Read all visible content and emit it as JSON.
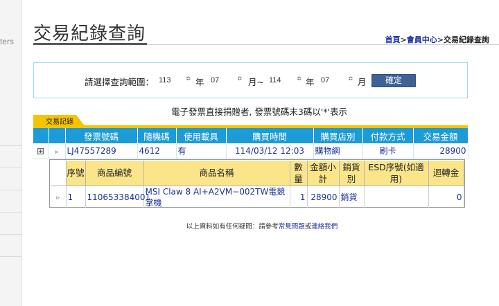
{
  "sidebar": {
    "fragment": "ters"
  },
  "header": {
    "title": "交易紀錄查詢",
    "breadcrumb": {
      "home": "首頁",
      "member": "會員中心",
      "current": "交易紀錄查詢",
      "separator": ">"
    }
  },
  "query": {
    "label": "請選擇查詢範圍：",
    "from_year": "113",
    "from_year_unit": "年",
    "from_month": "07",
    "from_month_unit": "月~",
    "to_year": "114",
    "to_year_unit": "年",
    "to_month": "07",
    "to_month_unit": "月",
    "spinner_icon": "≎",
    "confirm_label": "確定"
  },
  "notice": "電子發票直接捐贈者, 發票號碼末3碼以'*'表示",
  "tab_label": "交易記錄",
  "main_table": {
    "headers": [
      "發票號碼",
      "隨機碼",
      "使用載具",
      "購買時間",
      "購買店別",
      "付款方式",
      "交易金額"
    ],
    "row": {
      "expand": "+",
      "arrow": "▹",
      "invoice": "LJ47557289",
      "random_code": "4612",
      "carrier": "有",
      "time": "114/03/12 12:03",
      "store": "購物網",
      "payment": "刷卡",
      "amount": "28900"
    }
  },
  "detail_table": {
    "headers": [
      "序號",
      "商品編號",
      "商品名稱",
      "數量",
      "金額小計",
      "銷貨別",
      "ESD序號(如適用)",
      "迴轉金"
    ],
    "row": {
      "arrow": "▹",
      "seq": "1",
      "product_no": "110653384001",
      "product_name": "MSI Claw 8 AI+A2VM−002TW電競掌機",
      "qty": "1",
      "subtotal": "28900",
      "sale_type": "銷貨",
      "esd": "",
      "rebate": "0"
    }
  },
  "footer": {
    "prefix": "以上資料如有任何疑問：請參考",
    "faq_link": "常見問題",
    "or": "或",
    "contact_link": "連絡我們"
  },
  "colors": {
    "table_header_blue": "#1d9bd6",
    "detail_header_yellow": "#fbe58a",
    "tab_yellow": "#f5c400",
    "link_blue": "#1a2f9c",
    "button_blue": "#3f6296"
  }
}
